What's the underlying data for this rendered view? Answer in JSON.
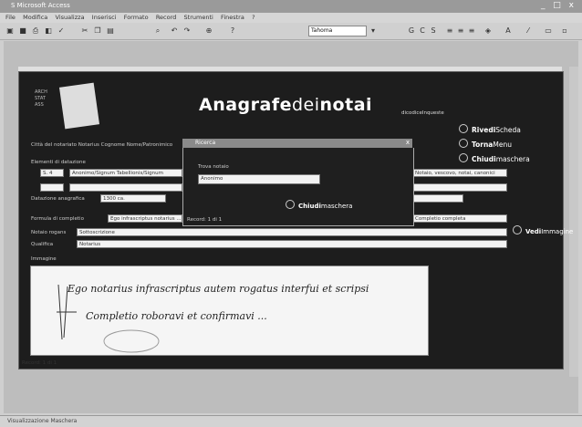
{
  "window": {
    "title": "S Microsoft Access",
    "controls": "_ □ x"
  },
  "menu": [
    "File",
    "Modifica",
    "Visualizza",
    "Inserisci",
    "Formato",
    "Record",
    "Strumenti",
    "Finestra",
    "?"
  ],
  "toolbar": {
    "font": "Tahoma"
  },
  "header": {
    "title_bold1": "Anagrafe",
    "title_thin": "dei",
    "title_bold2": "notai",
    "subtitle": "dicodiceInqueste",
    "logo_lines": [
      "ARCH",
      "STAT",
      "ASS"
    ]
  },
  "options": [
    {
      "bold": "Rivedi",
      "rest": "Scheda"
    },
    {
      "bold": "Torna",
      "rest": "Menu"
    },
    {
      "bold": "Chiudi",
      "rest": "maschera"
    }
  ],
  "form": {
    "row1_label": "Città del notariato  Notarius  Cognome  Nome/Patronimico",
    "sec_label": "Elementi di datazione",
    "field_a": "S. 4",
    "field_b": "Anonimo/Signum Tabellionis/Signum",
    "right_field": "Notaio, vescovo, notai, canonici",
    "date_label": "Datazione anagrafica",
    "date_value": "1300 ca.",
    "mode_label": "Formula di completio",
    "mode_value": "Ego infrascriptus notarius ...",
    "mode_right": "Completio completa",
    "view_bold": "Vedi",
    "view_rest": "Immagine",
    "sig_label": "Notaio rogans",
    "sig_value": "Sottoscrizione",
    "note_label": "Qualifica",
    "note_value": "Notarius",
    "img_label": "Immagine",
    "handwriting": [
      "Ego notarius infrascriptus autem rogatus interfui et scripsi",
      "Completio roboravi et confirmavi ... "
    ]
  },
  "dialog": {
    "title": "Ricerca",
    "field_label": "Trova notaio",
    "field_value": "Anonimo",
    "close_bold": "Chiudi",
    "close_rest": "maschera",
    "record_label": "Record:",
    "record_value": "1 di 1"
  },
  "record_nav": {
    "label": "Record:",
    "value": "1 di 1"
  },
  "status": "Visualizzazione Maschera"
}
